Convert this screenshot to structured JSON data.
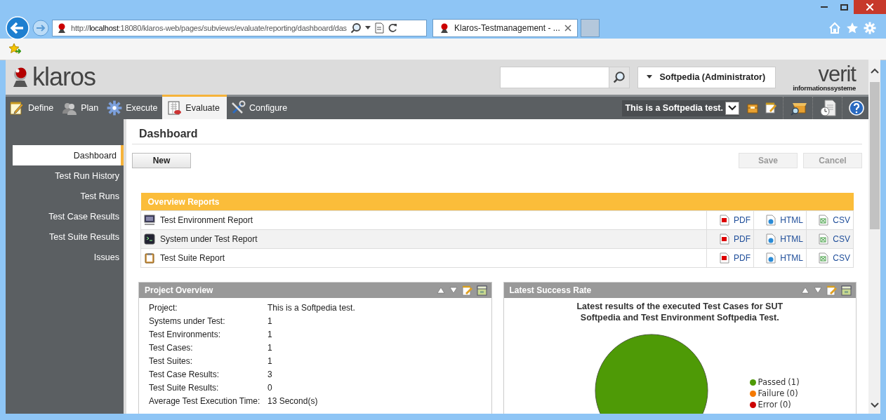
{
  "browser": {
    "address": "http://**localhost**:18080/klaros-web/pages/subviews/evaluate/reporting/dashboard/das",
    "tabs": [
      {
        "label": "Klaros-Testmanagement - ...",
        "selected": true
      }
    ]
  },
  "header": {
    "logo": "klaros",
    "user": "Softpedia (Administrator)",
    "partner_logo": {
      "name": "verit",
      "tagline": "informationssysteme"
    }
  },
  "nav": {
    "tabs": [
      {
        "label": "Define",
        "kind": "define",
        "selected": false
      },
      {
        "label": "Plan",
        "kind": "plan",
        "selected": false
      },
      {
        "label": "Execute",
        "kind": "execute",
        "selected": false
      },
      {
        "label": "Evaluate",
        "kind": "evaluate",
        "selected": true
      },
      {
        "label": "Configure",
        "kind": "configure",
        "selected": false
      }
    ],
    "project": "This is a Softpedia test."
  },
  "sidebar": {
    "items": [
      {
        "label": "Dashboard",
        "selected": true
      },
      {
        "label": "Test Run History",
        "selected": false
      },
      {
        "label": "Test Runs",
        "selected": false
      },
      {
        "label": "Test Case Results",
        "selected": false
      },
      {
        "label": "Test Suite Results",
        "selected": false
      },
      {
        "label": "Issues",
        "selected": false
      }
    ]
  },
  "page": {
    "title": "Dashboard",
    "buttons": [
      {
        "label": "New",
        "disabled": false
      },
      {
        "label": "Save",
        "disabled": true
      },
      {
        "label": "Cancel",
        "disabled": true
      }
    ]
  },
  "overview_reports": {
    "title": "Overview Reports",
    "rows": [
      {
        "name": "Test Environment Report",
        "kind": "environment",
        "formats": [
          {
            "label": "PDF",
            "kind": "pdf"
          },
          {
            "label": "HTML",
            "kind": "html"
          },
          {
            "label": "CSV",
            "kind": "csv"
          }
        ]
      },
      {
        "name": "System under Test Report",
        "kind": "system",
        "formats": [
          {
            "label": "PDF",
            "kind": "pdf"
          },
          {
            "label": "HTML",
            "kind": "html"
          },
          {
            "label": "CSV",
            "kind": "csv"
          }
        ]
      },
      {
        "name": "Test Suite Report",
        "kind": "suite",
        "formats": [
          {
            "label": "PDF",
            "kind": "pdf"
          },
          {
            "label": "HTML",
            "kind": "html"
          },
          {
            "label": "CSV",
            "kind": "csv"
          }
        ]
      }
    ]
  },
  "project_overview": {
    "title": "Project Overview",
    "fields": [
      {
        "label": "Project:",
        "value": "This is a Softpedia test."
      },
      {
        "label": "Systems under Test:",
        "value": "1"
      },
      {
        "label": "Test Environments:",
        "value": "1"
      },
      {
        "label": "Test Cases:",
        "value": "1"
      },
      {
        "label": "Test Suites:",
        "value": "1"
      },
      {
        "label": "Test Case Results:",
        "value": "3"
      },
      {
        "label": "Test Suite Results:",
        "value": "0"
      },
      {
        "label": "Average Test Execution Time:",
        "value": "13 Second(s)"
      }
    ]
  },
  "success_rate": {
    "title": "Latest Success Rate",
    "chart_data": {
      "type": "pie",
      "title": "Latest results of the executed Test Cases for SUT Softpedia and Test Environment Softpedia Test.",
      "categories": [
        "Passed",
        "Failure",
        "Error"
      ],
      "values": [
        1,
        0,
        0
      ]
    },
    "legend": [
      {
        "count": "(1)",
        "color": "#4e9a06"
      },
      {
        "count": "(0)",
        "color": "#f57900"
      },
      {
        "count": "(0)",
        "color": "#cc0000"
      }
    ]
  }
}
